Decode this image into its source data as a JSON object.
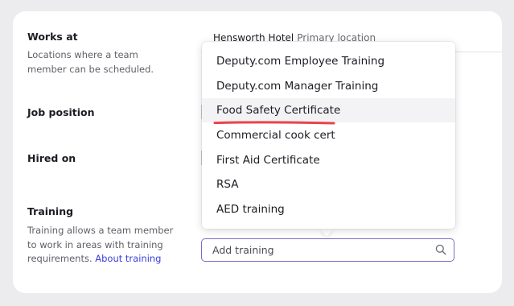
{
  "sections": {
    "works_at": {
      "title": "Works at",
      "description": "Locations where a team member can be scheduled.",
      "location_name": "Hensworth Hotel",
      "location_tag": "Primary location"
    },
    "job_position": {
      "title": "Job position"
    },
    "hired_on": {
      "title": "Hired on"
    },
    "training": {
      "title": "Training",
      "description": "Training allows a team member to work in areas with training requirements.",
      "link": "About training",
      "input_placeholder": "Add training"
    }
  },
  "dropdown": {
    "highlighted_index": 2,
    "options": [
      "Deputy.com Employee Training",
      "Deputy.com Manager Training",
      "Food Safety Certificate",
      "Commercial cook cert",
      "First Aid Certificate",
      "RSA",
      "AED training"
    ]
  },
  "colors": {
    "accent": "#7a6dc8",
    "link": "#3b3fd8",
    "annotation": "#e8444a"
  },
  "icons": {
    "search": "search-icon"
  }
}
